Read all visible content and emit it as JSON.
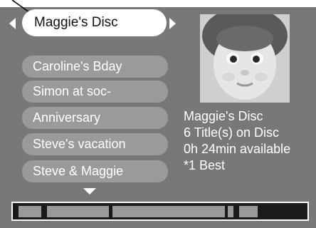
{
  "disc": {
    "selected_label": "Maggie's Disc"
  },
  "titles": [
    "Caroline's Bday",
    "Simon at soc-",
    "Anniversary",
    "Steve's vacation",
    "Steve & Maggie"
  ],
  "info": {
    "disc_name": "Maggie's Disc",
    "title_count": "6 Title(s) on Disc",
    "time_available": "0h 24min available",
    "quality": "*1 Best"
  },
  "timeline": {
    "segment_fractions": [
      0.08,
      0.21,
      0.39,
      0.02,
      0.06
    ]
  },
  "colors": {
    "background": "#787878",
    "pill": "#9a9a9a",
    "selected": "#ffffff",
    "bar": "#1a1a1a"
  }
}
